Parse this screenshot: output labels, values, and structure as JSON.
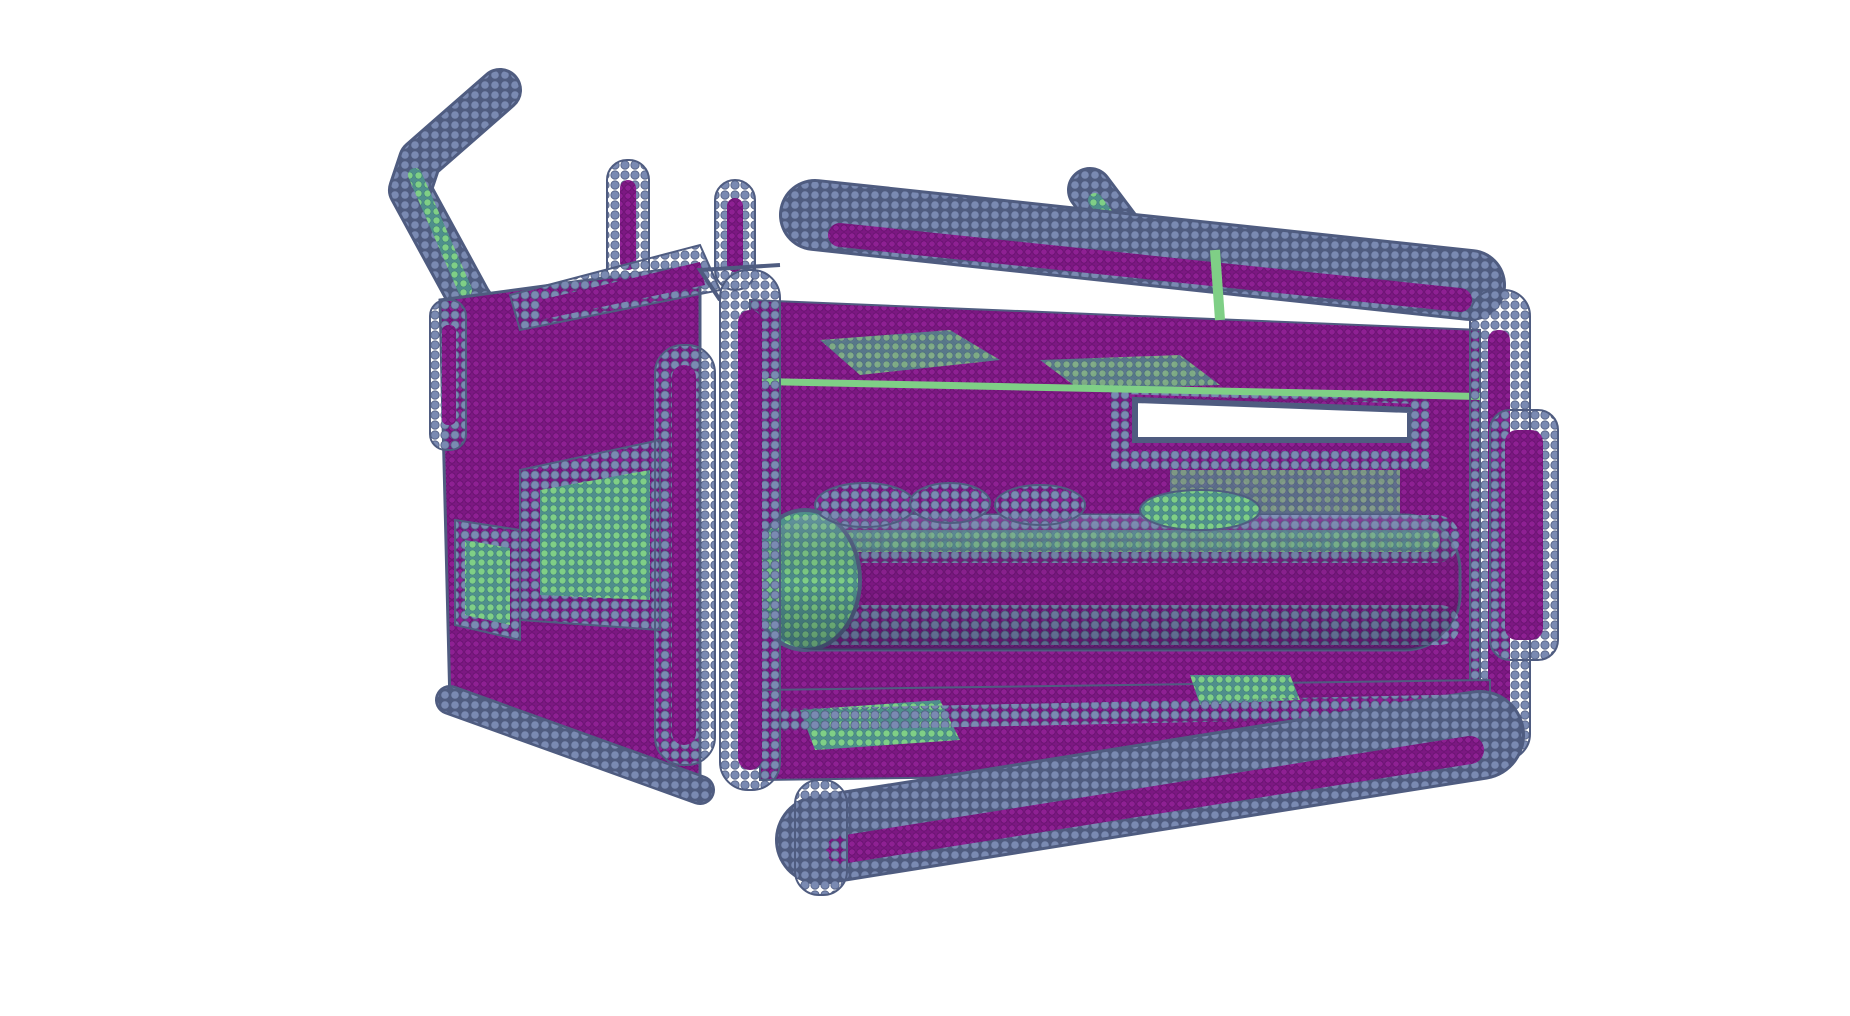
{
  "scene": {
    "subject": "particle-rendered-mechanical-frame",
    "colors": {
      "background": "#ffffff",
      "tube": "#6f7fa6",
      "tube_light": "#8796bc",
      "tube_dark": "#4f5c80",
      "panel": "#8a1c8c",
      "panel_dark": "#6a1470",
      "accent_green": "#7fcf86",
      "accent_teal": "#5aa9a6",
      "inner_shadow": "#3b2a5a"
    }
  }
}
